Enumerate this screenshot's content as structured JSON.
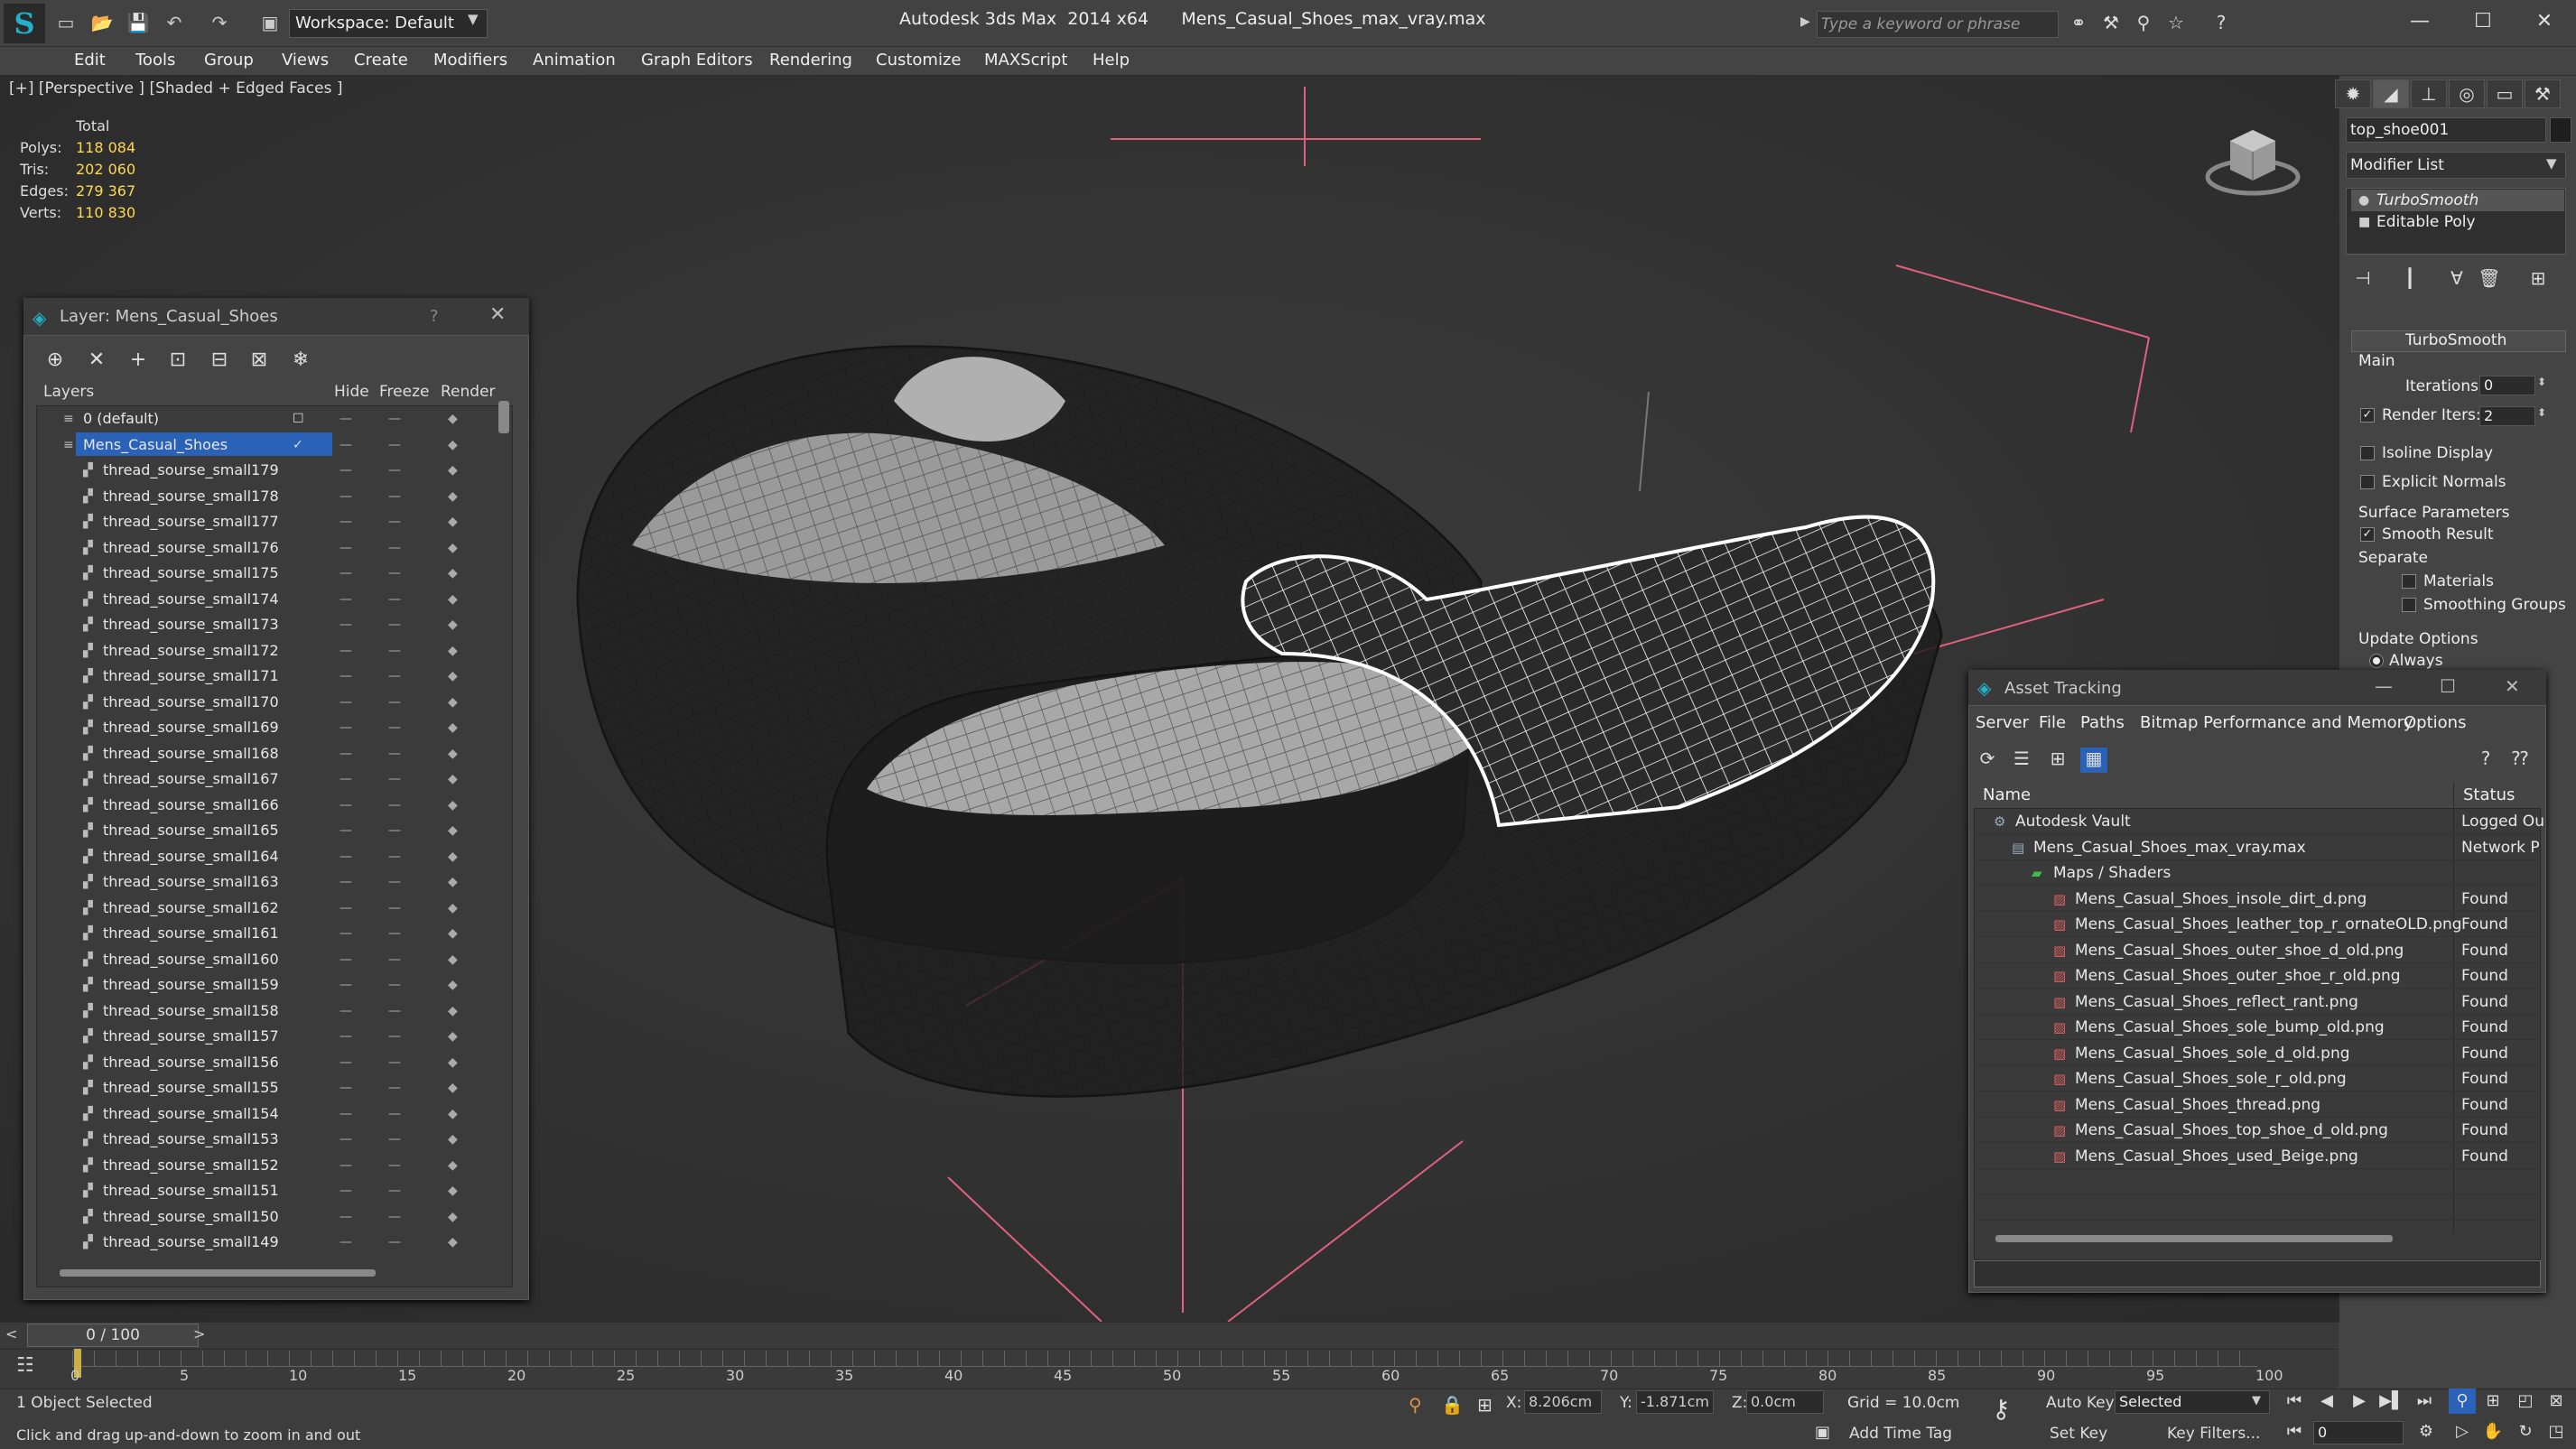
{
  "titlebar": {
    "workspace": "Workspace: Default",
    "app": "Autodesk 3ds Max  2014 x64",
    "file": "Mens_Casual_Shoes_max_vray.max",
    "search_placeholder": "Type a keyword or phrase"
  },
  "menu": [
    "Edit",
    "Tools",
    "Group",
    "Views",
    "Create",
    "Modifiers",
    "Animation",
    "Graph Editors",
    "Rendering",
    "Customize",
    "MAXScript",
    "Help"
  ],
  "viewport": {
    "label": "[+] [Perspective ] [Shaded + Edged Faces ]",
    "stats_header": "Total",
    "stats": [
      {
        "label": "Polys:",
        "value": "118 084"
      },
      {
        "label": "Tris:",
        "value": "202 060"
      },
      {
        "label": "Edges:",
        "value": "279 367"
      },
      {
        "label": "Verts:",
        "value": "110 830"
      }
    ]
  },
  "command_panel": {
    "object_name": "top_shoe001",
    "modifier_list": "Modifier List",
    "stack": [
      "TurboSmooth",
      "Editable Poly"
    ],
    "rollout_title": "TurboSmooth",
    "main_label": "Main",
    "iterations_label": "Iterations:",
    "iterations": "0",
    "render_iters_label": "Render Iters:",
    "render_iters": "2",
    "isoline": "Isoline Display",
    "explicit_normals": "Explicit Normals",
    "surface_params": "Surface Parameters",
    "smooth_result": "Smooth Result",
    "separate": "Separate",
    "materials": "Materials",
    "smoothing_groups": "Smoothing Groups",
    "update_options": "Update Options",
    "always": "Always"
  },
  "layer_dialog": {
    "title": "Layer: Mens_Casual_Shoes",
    "help": "?",
    "columns": {
      "layers": "Layers",
      "hide": "Hide",
      "freeze": "Freeze",
      "render": "Render"
    },
    "rows": [
      {
        "name": "0 (default)",
        "level": 1
      },
      {
        "name": "Mens_Casual_Shoes",
        "level": 1
      },
      {
        "name": "thread_sourse_small179",
        "level": 2
      },
      {
        "name": "thread_sourse_small178",
        "level": 2
      },
      {
        "name": "thread_sourse_small177",
        "level": 2
      },
      {
        "name": "thread_sourse_small176",
        "level": 2
      },
      {
        "name": "thread_sourse_small175",
        "level": 2
      },
      {
        "name": "thread_sourse_small174",
        "level": 2
      },
      {
        "name": "thread_sourse_small173",
        "level": 2
      },
      {
        "name": "thread_sourse_small172",
        "level": 2
      },
      {
        "name": "thread_sourse_small171",
        "level": 2
      },
      {
        "name": "thread_sourse_small170",
        "level": 2
      },
      {
        "name": "thread_sourse_small169",
        "level": 2
      },
      {
        "name": "thread_sourse_small168",
        "level": 2
      },
      {
        "name": "thread_sourse_small167",
        "level": 2
      },
      {
        "name": "thread_sourse_small166",
        "level": 2
      },
      {
        "name": "thread_sourse_small165",
        "level": 2
      },
      {
        "name": "thread_sourse_small164",
        "level": 2
      },
      {
        "name": "thread_sourse_small163",
        "level": 2
      },
      {
        "name": "thread_sourse_small162",
        "level": 2
      },
      {
        "name": "thread_sourse_small161",
        "level": 2
      },
      {
        "name": "thread_sourse_small160",
        "level": 2
      },
      {
        "name": "thread_sourse_small159",
        "level": 2
      },
      {
        "name": "thread_sourse_small158",
        "level": 2
      },
      {
        "name": "thread_sourse_small157",
        "level": 2
      },
      {
        "name": "thread_sourse_small156",
        "level": 2
      },
      {
        "name": "thread_sourse_small155",
        "level": 2
      },
      {
        "name": "thread_sourse_small154",
        "level": 2
      },
      {
        "name": "thread_sourse_small153",
        "level": 2
      },
      {
        "name": "thread_sourse_small152",
        "level": 2
      },
      {
        "name": "thread_sourse_small151",
        "level": 2
      },
      {
        "name": "thread_sourse_small150",
        "level": 2
      },
      {
        "name": "thread_sourse_small149",
        "level": 2
      }
    ]
  },
  "asset_dialog": {
    "title": "Asset Tracking",
    "menu": [
      "Server",
      "File",
      "Paths",
      "Bitmap Performance and Memory",
      "Options"
    ],
    "columns": {
      "name": "Name",
      "status": "Status"
    },
    "rows": [
      {
        "name": "Autodesk Vault",
        "status": "Logged Ou",
        "level": 1
      },
      {
        "name": "Mens_Casual_Shoes_max_vray.max",
        "status": "Network P",
        "level": 2
      },
      {
        "name": "Maps / Shaders",
        "status": "",
        "level": 3
      },
      {
        "name": "Mens_Casual_Shoes_insole_dirt_d.png",
        "status": "Found",
        "level": 4
      },
      {
        "name": "Mens_Casual_Shoes_leather_top_r_ornateOLD.png",
        "status": "Found",
        "level": 4
      },
      {
        "name": "Mens_Casual_Shoes_outer_shoe_d_old.png",
        "status": "Found",
        "level": 4
      },
      {
        "name": "Mens_Casual_Shoes_outer_shoe_r_old.png",
        "status": "Found",
        "level": 4
      },
      {
        "name": "Mens_Casual_Shoes_reflect_rant.png",
        "status": "Found",
        "level": 4
      },
      {
        "name": "Mens_Casual_Shoes_sole_bump_old.png",
        "status": "Found",
        "level": 4
      },
      {
        "name": "Mens_Casual_Shoes_sole_d_old.png",
        "status": "Found",
        "level": 4
      },
      {
        "name": "Mens_Casual_Shoes_sole_r_old.png",
        "status": "Found",
        "level": 4
      },
      {
        "name": "Mens_Casual_Shoes_thread.png",
        "status": "Found",
        "level": 4
      },
      {
        "name": "Mens_Casual_Shoes_top_shoe_d_old.png",
        "status": "Found",
        "level": 4
      },
      {
        "name": "Mens_Casual_Shoes_used_Beige.png",
        "status": "Found",
        "level": 4
      }
    ]
  },
  "timeline": {
    "frame_display": "0 / 100",
    "ticks": [
      "0",
      "5",
      "10",
      "15",
      "20",
      "25",
      "30",
      "35",
      "40",
      "45",
      "50",
      "55",
      "60",
      "65",
      "70",
      "75",
      "80",
      "85",
      "90",
      "95",
      "100"
    ]
  },
  "status": {
    "selected": "1 Object Selected",
    "prompt": "Click and drag up-and-down to zoom in and out",
    "x_label": "X:",
    "x": "8.206cm",
    "y_label": "Y:",
    "y": "-1.871cm",
    "z_label": "Z:",
    "z": "0.0cm",
    "grid": "Grid = 10.0cm",
    "auto_key": "Auto Key",
    "selected_set": "Selected",
    "set_key": "Set Key",
    "key_filters": "Key Filters...",
    "add_time_tag": "Add Time Tag",
    "frame": "0"
  },
  "colors": {
    "accent": "#23b0c8",
    "stat_value": "#ffd84a",
    "selection": "#2a62b8",
    "pink_gizmo": "#e06080"
  }
}
